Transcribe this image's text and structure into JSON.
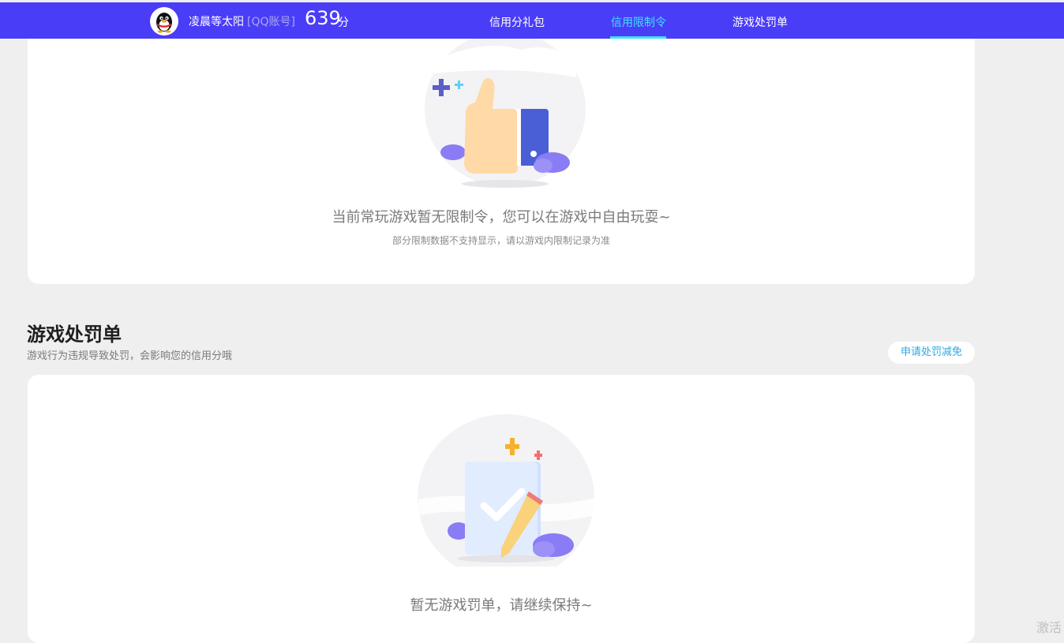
{
  "header": {
    "username": "凌晨等太阳",
    "account_tag": "[QQ账号]",
    "score": "639",
    "score_unit": "分",
    "nav": [
      {
        "label": "信用分礼包",
        "active": false
      },
      {
        "label": "信用限制令",
        "active": true
      },
      {
        "label": "游戏处罚单",
        "active": false
      }
    ]
  },
  "restriction_card": {
    "empty_text": "当前常玩游戏暂无限制令，您可以在游戏中自由玩耍~",
    "note_text": "部分限制数据不支持显示，请以游戏内限制记录为准"
  },
  "penalty_section": {
    "title": "游戏处罚单",
    "description": "游戏行为违规导致处罚，会影响您的信用分哦",
    "appeal_button": "申请处罚减免",
    "empty_text": "暂无游戏罚单，请继续保持~"
  },
  "watermark": "激活",
  "colors": {
    "header_bg": "#4a3df7",
    "active_nav": "#3fe3ff",
    "page_bg": "#efefef",
    "link": "#29a9e6"
  }
}
